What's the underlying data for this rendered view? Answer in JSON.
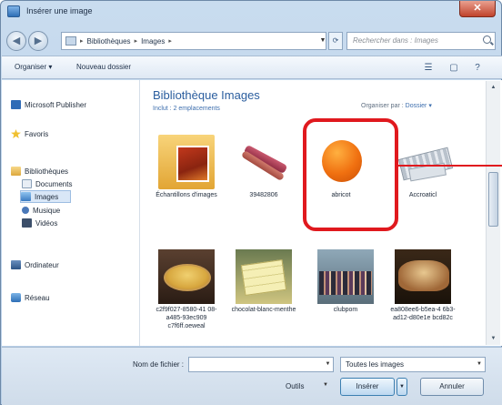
{
  "window": {
    "title": "Insérer une image",
    "close_glyph": "✕"
  },
  "address": {
    "breadcrumb": [
      "Bibliothèques",
      "Images"
    ],
    "search_placeholder": "Rechercher dans : Images"
  },
  "toolbar": {
    "organize": "Organiser ▾",
    "new_folder": "Nouveau dossier"
  },
  "nav": {
    "items": [
      {
        "label": "Microsoft Publisher",
        "icon": "publisher-icon"
      },
      {
        "label": "Favoris",
        "icon": "star-icon"
      },
      {
        "label": "Bibliothèques",
        "icon": "library-icon"
      },
      {
        "label": "Documents",
        "icon": "documents-icon"
      },
      {
        "label": "Images",
        "icon": "images-icon"
      },
      {
        "label": "Musique",
        "icon": "music-icon"
      },
      {
        "label": "Vidéos",
        "icon": "videos-icon"
      },
      {
        "label": "Ordinateur",
        "icon": "computer-icon"
      },
      {
        "label": "Réseau",
        "icon": "network-icon"
      }
    ]
  },
  "content": {
    "title": "Bibliothèque Images",
    "subtitle": "Inclut : 2 emplacements",
    "arrange_label": "Organiser par :",
    "arrange_value": "Dossier ▾",
    "files": [
      {
        "label": "Échantillons d'images"
      },
      {
        "label": "39482806"
      },
      {
        "label": "abricot"
      },
      {
        "label": "Accroaticl"
      },
      {
        "label": "c2f9f027-8580-41 08-a485-93ec909 c7f6ff.oeweal"
      },
      {
        "label": "chocolat-blanc-menthe"
      },
      {
        "label": "clubpom"
      },
      {
        "label": "ea808ee6-b5ea-4 6b3-ad12-d80e1e bcd82c"
      }
    ]
  },
  "bottom": {
    "filename_label": "Nom de fichier :",
    "filename_value": "",
    "filter": "Toutes les images",
    "tools": "Outils",
    "insert": "Insérer",
    "cancel": "Annuler"
  },
  "colors": {
    "highlight": "#e0191e",
    "title_blue": "#2a5d9e"
  }
}
